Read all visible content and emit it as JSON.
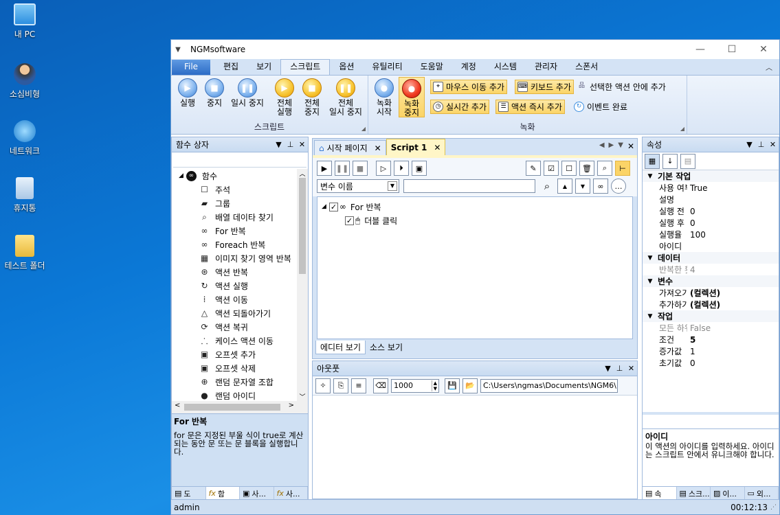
{
  "desktop": {
    "icons": [
      {
        "label": "내 PC"
      },
      {
        "label": "소심비형"
      },
      {
        "label": "네트워크"
      },
      {
        "label": "휴지통"
      },
      {
        "label": "테스트 폴더"
      }
    ]
  },
  "window": {
    "title": "NGMsoftware",
    "controls": {
      "minimize": "—",
      "maximize": "☐",
      "close": "✕"
    }
  },
  "ribbon": {
    "tabs": [
      "File",
      "편집",
      "보기",
      "스크립트",
      "옵션",
      "유틸리티",
      "도움말",
      "계정",
      "시스템",
      "관리자",
      "스폰서"
    ],
    "active_tab": "스크립트",
    "script_group": {
      "name": "스크립트",
      "buttons": [
        {
          "label1": "실행",
          "label2": ""
        },
        {
          "label1": "중지",
          "label2": ""
        },
        {
          "label1": "일시 중지",
          "label2": ""
        },
        {
          "label1": "전체",
          "label2": "실행"
        },
        {
          "label1": "전체",
          "label2": "중지"
        },
        {
          "label1": "전체",
          "label2": "일시 중지"
        }
      ]
    },
    "record_group": {
      "name": "녹화",
      "record_start": {
        "label1": "녹화",
        "label2": "시작"
      },
      "record_stop": {
        "label1": "녹화",
        "label2": "중지"
      },
      "mouse_move": "마우스 이동 추가",
      "keyboard": "키보드 추가",
      "inside_selected": "선택한 액션 안에 추가",
      "realtime": "실시간 추가",
      "instant": "액션 즉시 추가",
      "event_done": "이벤트 완료"
    }
  },
  "left_panel": {
    "title": "함수 상자",
    "tree_root": "함수",
    "items": [
      "주석",
      "그룹",
      "배열 데이타 찾기",
      "For 반복",
      "Foreach 반복",
      "이미지 찾기 영역 반복",
      "액션 반복",
      "액션 실행",
      "액션 이동",
      "액션 되돌아가기",
      "액션 복귀",
      "케이스 액션 이동",
      "오프셋 추가",
      "오프셋 삭제",
      "랜덤 문자열 조합",
      "랜덤 아이디"
    ],
    "desc_title": "For 반복",
    "desc_text": "for 문은 지정된 부울 식이 true로 계산되는 동안 문 또는 문 블록을 실행합니다.",
    "bottom_tabs": [
      "도",
      "함",
      "사...",
      "사..."
    ]
  },
  "editor": {
    "tabs": [
      "시작 페이지",
      "Script 1"
    ],
    "active_tab": "Script 1",
    "var_select": "변수 이름",
    "search_value": "",
    "tree": [
      {
        "label": "For 반복",
        "level": 0
      },
      {
        "label": "더블 클릭",
        "level": 1
      }
    ],
    "view_tabs": [
      "에디터 보기",
      "소스 보기"
    ]
  },
  "output": {
    "title": "아웃풋",
    "count": "1000",
    "path": "C:\\Users\\ngmas\\Documents\\NGM6\\"
  },
  "properties": {
    "title": "속성",
    "categories": [
      {
        "name": "기본 작업",
        "rows": [
          {
            "k": "사용 여부",
            "v": "True",
            "bold": false,
            "gray": false
          },
          {
            "k": "설명",
            "v": "",
            "bold": false,
            "gray": false
          },
          {
            "k": "실행 전 지연",
            "v": "0",
            "bold": false,
            "gray": false
          },
          {
            "k": "실행 후 지연",
            "v": "0",
            "bold": false,
            "gray": false
          },
          {
            "k": "실행율",
            "v": "100",
            "bold": false,
            "gray": false
          },
          {
            "k": "아이디",
            "v": "",
            "bold": false,
            "gray": false
          }
        ]
      },
      {
        "name": "데이터",
        "rows": [
          {
            "k": "반복한 횟수",
            "v": "4",
            "bold": false,
            "gray": true
          }
        ]
      },
      {
        "name": "변수",
        "rows": [
          {
            "k": "가져오기",
            "v": "(컬렉션)",
            "bold": true,
            "gray": false
          },
          {
            "k": "추가하기",
            "v": "(컬렉션)",
            "bold": true,
            "gray": false
          }
        ]
      },
      {
        "name": "작업",
        "rows": [
          {
            "k": "모든 하위",
            "v": "False",
            "bold": false,
            "gray": true
          },
          {
            "k": "조건",
            "v": "5",
            "bold": true,
            "gray": false
          },
          {
            "k": "증가값",
            "v": "1",
            "bold": false,
            "gray": false
          },
          {
            "k": "초기값",
            "v": "0",
            "bold": false,
            "gray": false
          }
        ]
      }
    ],
    "desc_title": "아이디",
    "desc_text": "이 액션의 아이디를 입력하세요. 아이디는 스크립트 안에서 유니크해야 합니다.",
    "bottom_tabs": [
      "속",
      "스크...",
      "이...",
      "외..."
    ]
  },
  "status": {
    "user": "admin",
    "time": "00:12:13"
  }
}
